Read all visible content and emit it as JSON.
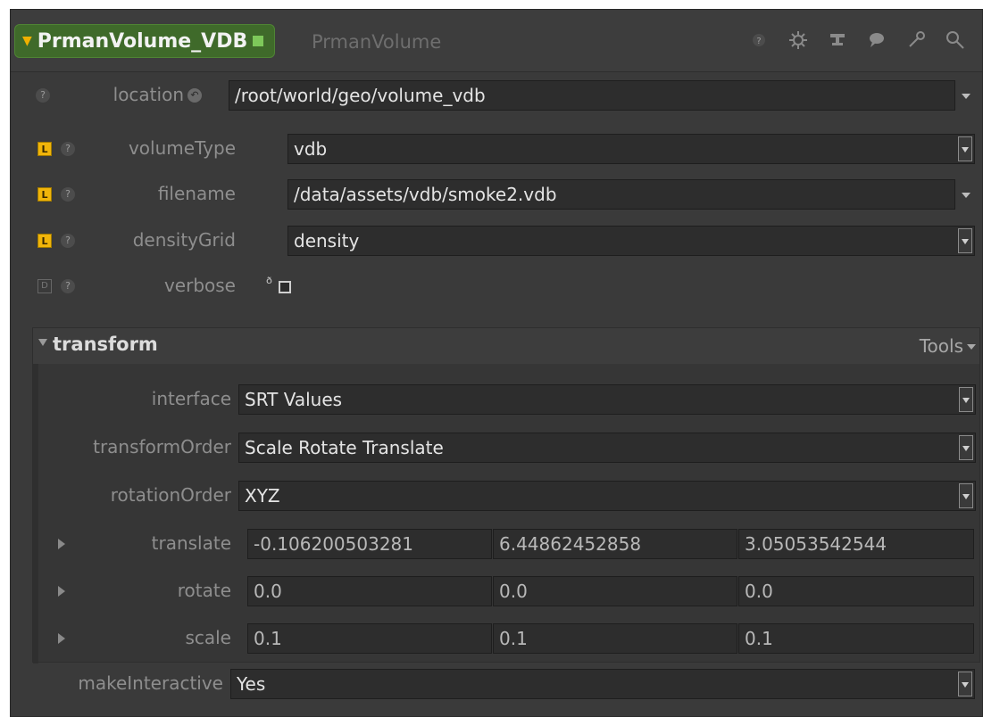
{
  "node": {
    "name": "PrmanVolume_VDB",
    "type": "PrmanVolume"
  },
  "header_icons": [
    "help-icon",
    "gear-icon",
    "network-icon",
    "comment-icon",
    "wrench-icon",
    "search-icon"
  ],
  "params": {
    "location": {
      "label": "location",
      "value": "/root/world/geo/volume_vdb"
    },
    "volumeType": {
      "label": "volumeType",
      "value": "vdb",
      "badge": "L"
    },
    "filename": {
      "label": "filename",
      "value": "/data/assets/vdb/smoke2.vdb",
      "badge": "L"
    },
    "densityGrid": {
      "label": "densityGrid",
      "value": "density",
      "badge": "L"
    },
    "verbose": {
      "label": "verbose",
      "badge": "D",
      "checked": false
    }
  },
  "transform": {
    "title": "transform",
    "tools_label": "Tools",
    "interface": {
      "label": "interface",
      "value": "SRT Values"
    },
    "transformOrder": {
      "label": "transformOrder",
      "value": "Scale Rotate Translate"
    },
    "rotationOrder": {
      "label": "rotationOrder",
      "value": "XYZ"
    },
    "translate": {
      "label": "translate",
      "values": [
        "-0.106200503281",
        "6.44862452858",
        "3.05053542544"
      ]
    },
    "rotate": {
      "label": "rotate",
      "values": [
        "0.0",
        "0.0",
        "0.0"
      ]
    },
    "scale": {
      "label": "scale",
      "values": [
        "0.1",
        "0.1",
        "0.1"
      ]
    }
  },
  "makeInteractive": {
    "label": "makeInteractive",
    "value": "Yes"
  }
}
